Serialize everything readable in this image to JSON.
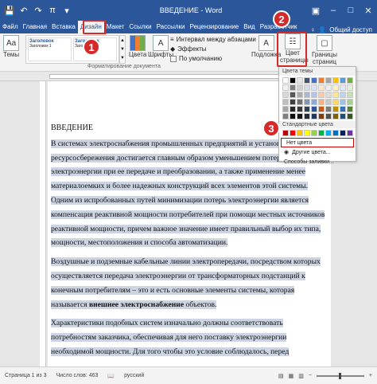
{
  "window": {
    "title": "ВВЕДЕНИЕ - Word"
  },
  "qat": {
    "save_icon": "save-icon",
    "undo_icon": "undo-icon",
    "redo_icon": "redo-icon",
    "pi_symbol": "π"
  },
  "tabs": [
    "Файл",
    "Главная",
    "Вставка",
    "Дизайн",
    "Макет",
    "Ссылки",
    "Рассылки",
    "Рецензирование",
    "Вид",
    "Разработчик"
  ],
  "tabs_active_index": 3,
  "tabs_right": {
    "tell_me": "♀",
    "share": "Общий доступ"
  },
  "ribbon": {
    "themes_label": "Темы",
    "style_thumbs": [
      {
        "title": "Заголовок",
        "body": "Заголовок 1"
      },
      {
        "title": "Заголовок",
        "body": "Заголовок 1"
      }
    ],
    "colors_label": "Цвета",
    "fonts_label": "Шрифты",
    "para_spacing": "Интервал между абзацами",
    "effects": "Эффекты",
    "default": "По умолчанию",
    "group_label": "Форматирование документа",
    "watermark_label": "Подложка",
    "page_color_label": "Цвет страницы",
    "page_borders_label": "Границы страниц"
  },
  "dropdown": {
    "theme_colors_label": "Цвета темы",
    "standard_colors_label": "Стандартные цвета",
    "no_color": "Нет цвета",
    "other_colors": "Другие цвета...",
    "fill_methods": "Способы заливки...",
    "theme_colors": [
      [
        "#ffffff",
        "#000000",
        "#e7e6e6",
        "#44546a",
        "#4472c4",
        "#ed7d31",
        "#a5a5a5",
        "#ffc000",
        "#5b9bd5",
        "#70ad47"
      ],
      [
        "#f2f2f2",
        "#808080",
        "#d0cece",
        "#d6dce4",
        "#d9e2f3",
        "#fbe5d5",
        "#ededed",
        "#fff2cc",
        "#deeaf6",
        "#e2efd9"
      ],
      [
        "#d9d9d9",
        "#595959",
        "#aeabab",
        "#adb9ca",
        "#b4c6e7",
        "#f7cbac",
        "#dbdbdb",
        "#fee599",
        "#bdd6ee",
        "#c5e0b3"
      ],
      [
        "#bfbfbf",
        "#404040",
        "#757070",
        "#8496b0",
        "#8eaadb",
        "#f4b183",
        "#c9c9c9",
        "#ffd965",
        "#9cc3e5",
        "#a8d08d"
      ],
      [
        "#a6a6a6",
        "#262626",
        "#3a3838",
        "#323f4f",
        "#2f5496",
        "#c55a11",
        "#7b7b7b",
        "#bf8f00",
        "#2e75b5",
        "#538135"
      ],
      [
        "#7f7f7f",
        "#0d0d0d",
        "#171616",
        "#222a35",
        "#1f3763",
        "#833c0b",
        "#525252",
        "#7f6000",
        "#1e4e79",
        "#375623"
      ]
    ],
    "standard_colors": [
      "#c00000",
      "#ff0000",
      "#ffc000",
      "#ffff00",
      "#92d050",
      "#00b050",
      "#00b0f0",
      "#0070c0",
      "#002060",
      "#7030a0"
    ]
  },
  "markers": [
    "1",
    "2",
    "3"
  ],
  "document": {
    "heading": "ВВЕДЕНИЕ",
    "paragraphs": [
      "В системах электроснабжения промышленных предприятий и установок - и ресурсосбережения достигается главным образом уменьшением потерь электроэнергии при ее передаче и преобразовании, а также применение менее материалоемких и более надежных конструкций всех элементов этой системы. Одним из испробованных путей минимизации потерь электроэнергии является компенсация реактивной мощности потребителей при помощи местных источников реактивной мощности, причем важное значение имеет правильный выбор их типа, мощности, местоположения и способа автоматизации.",
      "Воздушные и подземные кабельные линии электропередачи, посредством которых осуществляется передача электроэнергии от трансформаторных подстанций к конечным потребителям – это и есть основные элементы системы, которая называется",
      "Характеристики подобных систем изначально должны соответствовать потребностям заказчика, обеспечивая для него поставку электроэнергии необходимой мощности. Для того чтобы это условие соблюдалось, перед"
    ],
    "bold_term": "внешнее электроснабжение",
    "para2_tail": " объектов."
  },
  "status": {
    "page": "Страница 1 из 3",
    "words": "Число слов: 463",
    "lang": "русский",
    "zoom_minus": "−",
    "zoom_plus": "+"
  }
}
